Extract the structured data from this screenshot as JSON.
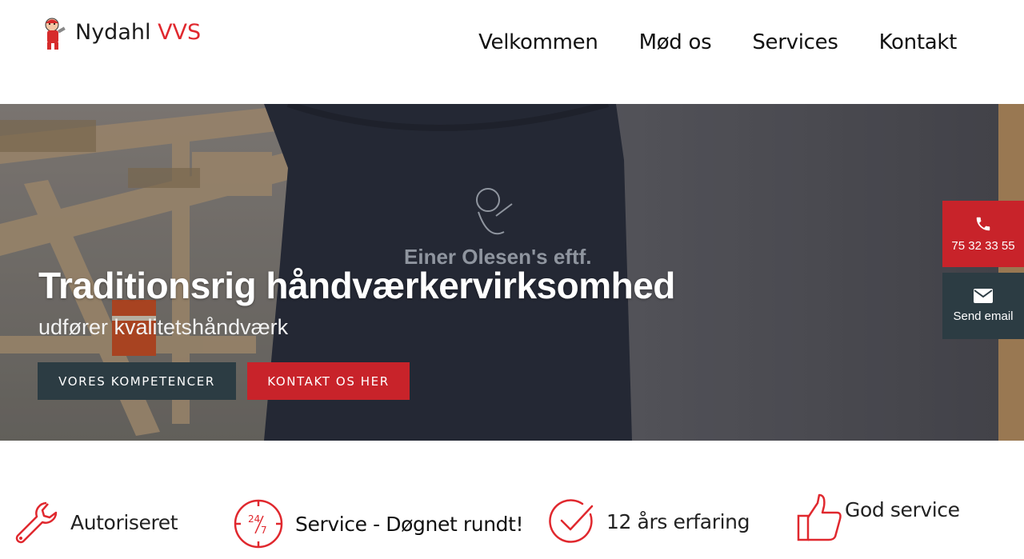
{
  "header": {
    "logo_name": "Nydahl",
    "logo_accent": "VVS",
    "nav": [
      "Velkommen",
      "Mød os",
      "Services",
      "Kontakt"
    ]
  },
  "hero": {
    "title": "Traditionsrig håndværkervirksomhed",
    "subtitle": "udfører kvalitetshåndværk",
    "buttons": {
      "competencies": "VORES KOMPETENCER",
      "contact": "KONTAKT OS HER"
    },
    "hoodie_text": "Einer Olesen's eftf."
  },
  "side": {
    "phone": "75 32 33 55",
    "email": "Send email"
  },
  "features": [
    {
      "label": "Autoriseret",
      "icon": "wrench-icon"
    },
    {
      "label": "Service - Døgnet rundt!",
      "icon": "clock-24-7-icon"
    },
    {
      "label": "12 års erfaring",
      "icon": "check-circle-icon"
    },
    {
      "label": "God service",
      "icon": "thumbs-up-icon"
    }
  ],
  "colors": {
    "accent_red": "#e0282e",
    "button_red": "#c8232a",
    "button_dark": "#2c3c43"
  }
}
